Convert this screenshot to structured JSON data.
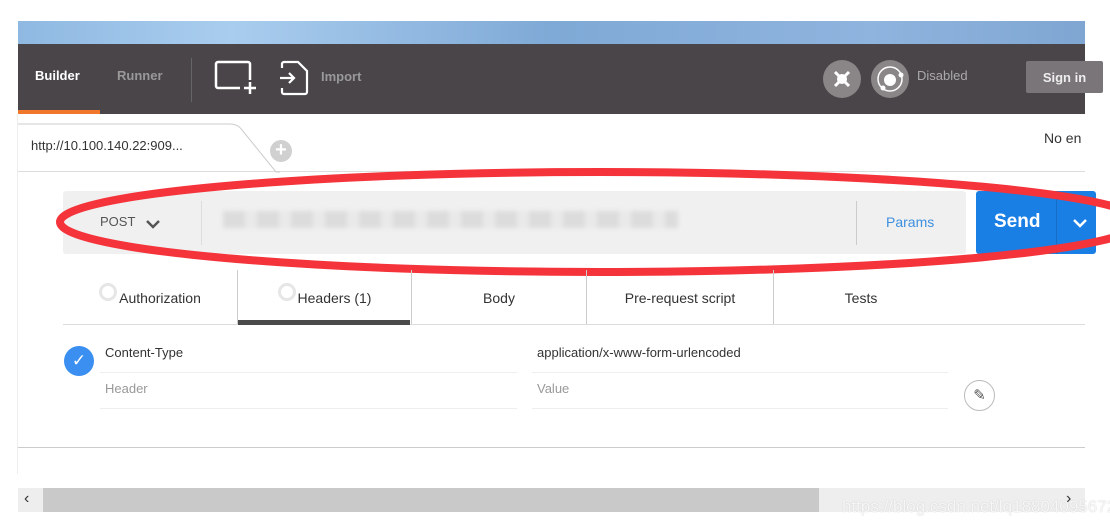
{
  "topbar": {
    "builder": "Builder",
    "runner": "Runner",
    "import": "Import",
    "interceptor_status": "Disabled",
    "sign_in": "Sign in"
  },
  "request_tab": {
    "label": "http://10.100.140.22:909...",
    "add": "+"
  },
  "environment": "No en",
  "url_bar": {
    "method": "POST",
    "chevron": "❯",
    "params": "Params",
    "send": "Send"
  },
  "tabs": [
    {
      "label": "Authorization"
    },
    {
      "label": "Headers (1)",
      "active": true
    },
    {
      "label": "Body"
    },
    {
      "label": "Pre-request script"
    },
    {
      "label": "Tests"
    }
  ],
  "headers": {
    "rows": [
      {
        "key": "Content-Type",
        "value": "application/x-www-form-urlencoded",
        "enabled": true
      }
    ],
    "key_placeholder": "Header",
    "value_placeholder": "Value"
  },
  "accent": {
    "orange": "#f0762b",
    "blue": "#1a7fe5",
    "annotation_red": "#f5333a"
  },
  "watermark": "https://blog.csdn.net/lq18804095672"
}
